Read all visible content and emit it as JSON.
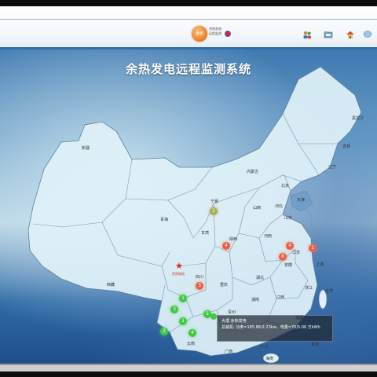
{
  "header": {
    "logo_badge": "余热",
    "logo_text_line1": "余热发电",
    "logo_text_line2": "远程监测"
  },
  "toolbar": {
    "icons": [
      "users-icon",
      "folder-icon",
      "home-icon",
      "chat-icon"
    ]
  },
  "map": {
    "title": "余热发电远程监测系统",
    "provinces": [
      {
        "id": "xinjiang",
        "name": "新疆"
      },
      {
        "id": "xizang",
        "name": "西藏"
      },
      {
        "id": "qinghai",
        "name": "青海"
      },
      {
        "id": "gansu",
        "name": "甘肃"
      },
      {
        "id": "sichuan",
        "name": "四川"
      },
      {
        "id": "yunnan",
        "name": "云南"
      },
      {
        "id": "neimenggu",
        "name": "内蒙古"
      },
      {
        "id": "heilongjiang",
        "name": "黑龙江"
      },
      {
        "id": "jilin",
        "name": "吉林"
      },
      {
        "id": "liaoning",
        "name": "辽宁"
      },
      {
        "id": "hebei",
        "name": "河北"
      },
      {
        "id": "beijing",
        "name": "北京"
      },
      {
        "id": "tianjin",
        "name": "天津"
      },
      {
        "id": "shanxi",
        "name": "山西"
      },
      {
        "id": "shandong",
        "name": "山东"
      },
      {
        "id": "henan",
        "name": "河南"
      },
      {
        "id": "shaanxi",
        "name": "陕西"
      },
      {
        "id": "ningxia",
        "name": "宁夏"
      },
      {
        "id": "jiangsu",
        "name": "江苏"
      },
      {
        "id": "anhui",
        "name": "安徽"
      },
      {
        "id": "hubei",
        "name": "湖北"
      },
      {
        "id": "chongqing",
        "name": "重庆"
      },
      {
        "id": "guizhou",
        "name": "贵州"
      },
      {
        "id": "hunan",
        "name": "湖南"
      },
      {
        "id": "jiangxi",
        "name": "江西"
      },
      {
        "id": "zhejiang",
        "name": "浙江"
      },
      {
        "id": "shanghai",
        "name": "上海"
      },
      {
        "id": "fujian",
        "name": "福建"
      },
      {
        "id": "guangxi",
        "name": "广西"
      },
      {
        "id": "guangdong",
        "name": "广东"
      },
      {
        "id": "hainan",
        "name": "海南"
      },
      {
        "id": "taiwan",
        "name": "台湾"
      },
      {
        "id": "hongkong",
        "name": "香港"
      }
    ],
    "markers": [
      {
        "id": "ningxia-site",
        "label": "2",
        "style": "olive"
      },
      {
        "id": "shaanxi-site",
        "label": "4",
        "style": "red"
      },
      {
        "id": "sichuan-site",
        "label": "3",
        "style": "red"
      },
      {
        "id": "jiangsu-site",
        "label": "1",
        "style": "red"
      },
      {
        "id": "anhui-site",
        "label": "8",
        "style": "red"
      },
      {
        "id": "henan-site",
        "label": "4",
        "style": "red"
      },
      {
        "id": "yunnan-site-1",
        "label": "3",
        "style": "green"
      },
      {
        "id": "yunnan-site-2",
        "label": "1",
        "style": "green"
      },
      {
        "id": "yunnan-site-3",
        "label": "2",
        "style": "green"
      },
      {
        "id": "yunnan-site-4",
        "label": "4",
        "style": "green"
      },
      {
        "id": "guizhou-site",
        "label": "5",
        "style": "green"
      },
      {
        "id": "yunnan-site-5",
        "label": "1",
        "style": "green"
      }
    ],
    "headquarters_label": "余热电站",
    "tooltip": {
      "line1": "大理 余热发电",
      "line2": "总装机: 功率=185.86/2.23kw，电量=75/5.06 万kWh"
    }
  }
}
